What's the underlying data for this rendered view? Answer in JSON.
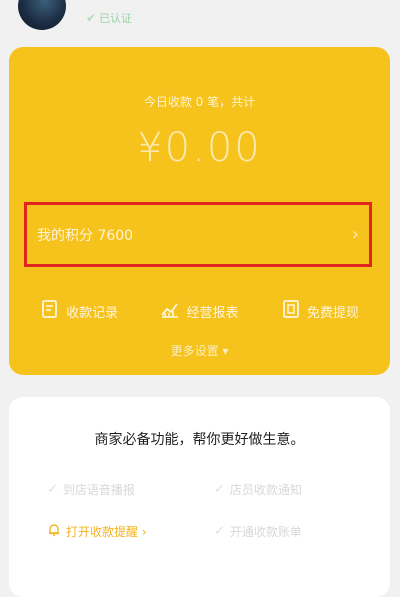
{
  "header": {
    "verified_icon": "verified-check-icon",
    "verified_label": "已认证"
  },
  "card": {
    "today_label": "今日收款 0 笔，共计",
    "amount": "¥0.00",
    "points_label": "我的积分 7600",
    "points_chevron": "›",
    "tools": [
      {
        "label": "收款记录",
        "icon": "record-icon"
      },
      {
        "label": "经营报表",
        "icon": "report-chart-icon"
      },
      {
        "label": "免费提现",
        "icon": "withdraw-icon"
      }
    ],
    "more_settings": "更多设置 ▾"
  },
  "panel": {
    "title": "商家必备功能，帮你更好做生意。",
    "features": [
      {
        "label": "到店语音播报"
      },
      {
        "label": "店员收款通知"
      },
      {
        "label": "打开收款提醒"
      },
      {
        "label": "开通收款账单"
      }
    ],
    "voice_label": "打开收款提醒 ›"
  },
  "colors": {
    "card_bg": "#f6c21c",
    "highlight_border": "#e0261e",
    "accent": "#f4b321"
  }
}
